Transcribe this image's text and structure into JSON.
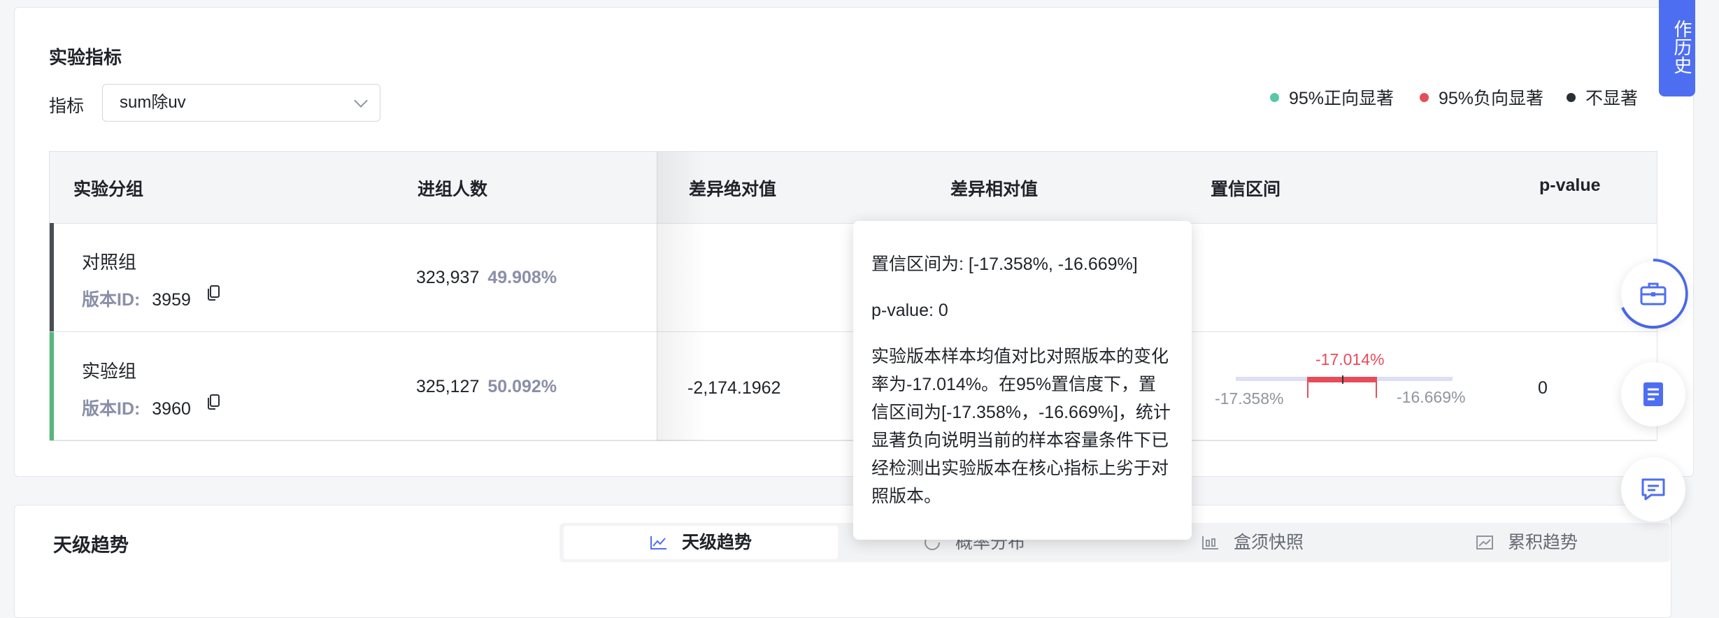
{
  "section": {
    "title": "实验指标"
  },
  "metric": {
    "label": "指标",
    "value": "sum除uv"
  },
  "legend": [
    {
      "label": "95%正向显著",
      "color": "#57c7a8"
    },
    {
      "label": "95%负向显著",
      "color": "#e54d5a"
    },
    {
      "label": "不显著",
      "color": "#2b2f36"
    }
  ],
  "table": {
    "headers": [
      "实验分组",
      "进组人数",
      "差异绝对值",
      "差异相对值",
      "置信区间",
      "p-value"
    ],
    "rows": [
      {
        "group": "对照组",
        "version_label": "版本ID:",
        "version_id": "3959",
        "users": "323,937",
        "users_pct": "49.908%",
        "abs_diff": "",
        "p_value": "",
        "bar_color": "#4a4d55"
      },
      {
        "group": "实验组",
        "version_label": "版本ID:",
        "version_id": "3960",
        "users": "325,127",
        "users_pct": "50.092%",
        "abs_diff": "-2,174.1962",
        "p_value": "0",
        "bar_color": "#57b77a"
      }
    ],
    "ci": {
      "center": "-17.014%",
      "low": "-17.358%",
      "high": "-16.669%",
      "color": "#e54d5a"
    }
  },
  "tooltip": {
    "ci_line": "置信区间为: [-17.358%, -16.669%]",
    "p_line": "p-value: 0",
    "desc": "实验版本样本均值对比对照版本的变化率为-17.014%。在95%置信度下，置信区间为[-17.358%，-16.669%]，统计显著负向说明当前的样本容量条件下已经检测出实验版本在核心指标上劣于对照版本。"
  },
  "history_tab": {
    "label": "作历史"
  },
  "fabs": [
    {
      "icon": "toolbox-icon"
    },
    {
      "icon": "document-icon"
    },
    {
      "icon": "feedback-icon"
    }
  ],
  "trend": {
    "title": "天级趋势",
    "tabs": [
      {
        "label": "天级趋势",
        "icon": "line-chart-icon"
      },
      {
        "label": "概率分布",
        "icon": "pie-icon"
      },
      {
        "label": "盒须快照",
        "icon": "box-plot-icon"
      },
      {
        "label": "累积趋势",
        "icon": "area-chart-icon"
      }
    ]
  },
  "colors": {
    "accent": "#4e6ef2"
  }
}
